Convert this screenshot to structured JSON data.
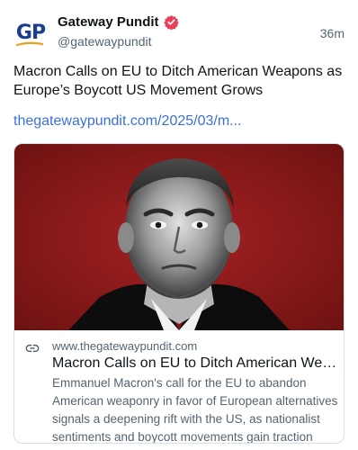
{
  "post": {
    "author": {
      "avatar_text": "GP",
      "display_name": "Gateway Pundit",
      "handle": "@gatewaypundit",
      "verified": true
    },
    "timestamp": "36m",
    "text": "Macron Calls on EU to Ditch American Weapons as Europe’s Boycott US Movement Grows",
    "link_text": "thegatewaypundit.com/2025/03/m..."
  },
  "card": {
    "domain": "www.thegatewaypundit.com",
    "title": "Macron Calls on EU to Ditch American Weapons as Europe’s Boycott US Movement Grows",
    "description": "Emmanuel Macron's call for the EU to abandon American weaponry in favor of European alternatives signals a deepening rift with the US, as nationalist sentiments and boycott movements gain traction acro...",
    "image_icon": "portrait-photo"
  },
  "colors": {
    "link": "#3b6fe0",
    "verified_badge": "#e8405a",
    "avatar_text": "#1a3d8f",
    "avatar_swoosh": "#e8a020",
    "image_background": "#8b1a1a"
  }
}
